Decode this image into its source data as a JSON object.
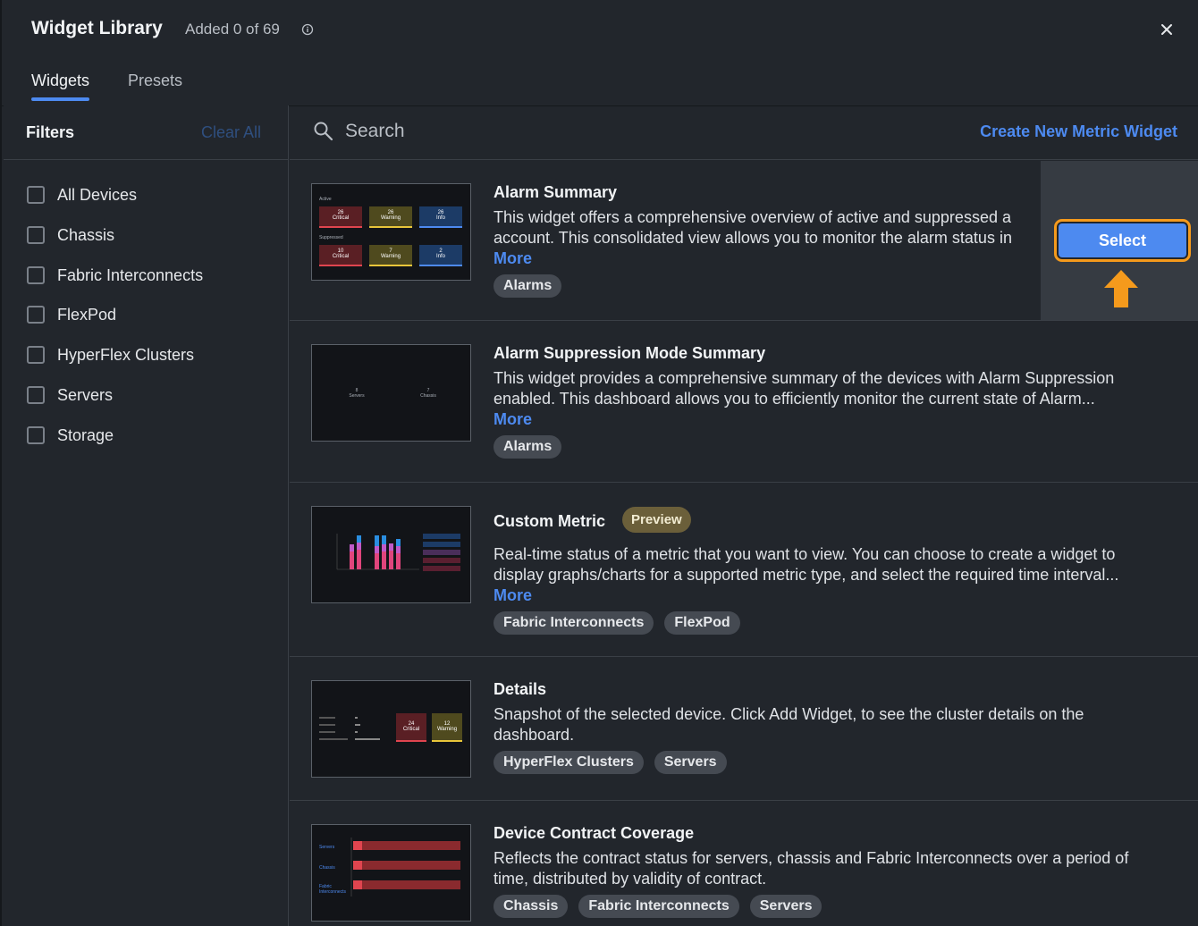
{
  "header": {
    "title": "Widget Library",
    "added_text": "Added 0 of 69"
  },
  "tabs": [
    {
      "label": "Widgets",
      "active": true
    },
    {
      "label": "Presets",
      "active": false
    }
  ],
  "filters": {
    "heading": "Filters",
    "clear_all": "Clear All",
    "items": [
      {
        "label": "All Devices",
        "checked": false
      },
      {
        "label": "Chassis",
        "checked": false
      },
      {
        "label": "Fabric Interconnects",
        "checked": false
      },
      {
        "label": "FlexPod",
        "checked": false
      },
      {
        "label": "HyperFlex Clusters",
        "checked": false
      },
      {
        "label": "Servers",
        "checked": false
      },
      {
        "label": "Storage",
        "checked": false
      }
    ]
  },
  "search": {
    "placeholder": "Search",
    "value": ""
  },
  "create_link": "Create New Metric Widget",
  "select_button": "Select",
  "widgets": [
    {
      "title": "Alarm Summary",
      "desc1": "This widget offers a comprehensive overview of active and suppressed a",
      "desc2": "account. This consolidated view allows you to monitor the alarm status in",
      "more": "More",
      "tags": [
        "Alarms"
      ],
      "thumb": {
        "active": "Active",
        "suppressed": "Suppressed",
        "tiles": [
          {
            "value": "26",
            "label": "Critical"
          },
          {
            "value": "26",
            "label": "Warning"
          },
          {
            "value": "26",
            "label": "Info"
          },
          {
            "value": "10",
            "label": "Critical"
          },
          {
            "value": "7",
            "label": "Warning"
          },
          {
            "value": "2",
            "label": "Info"
          }
        ]
      }
    },
    {
      "title": "Alarm Suppression Mode Summary",
      "desc1": "This widget provides a comprehensive summary of the devices with Alarm Suppression",
      "desc2": "enabled. This dashboard allows you to efficiently monitor the current state of Alarm...",
      "more": "More",
      "tags": [
        "Alarms"
      ],
      "thumb": {
        "a_value": "8",
        "a_label": "Servers",
        "b_value": "7",
        "b_label": "Chassis"
      }
    },
    {
      "title": "Custom Metric",
      "badge": "Preview",
      "desc1": "Real-time status of a metric that you want to view. You can choose to create a widget to",
      "desc2": "display graphs/charts for a supported metric type, and select the required time interval...",
      "more": "More",
      "tags": [
        "Fabric Interconnects",
        "FlexPod"
      ]
    },
    {
      "title": "Details",
      "desc1": "Snapshot of the selected device. Click Add Widget, to see the cluster details on the",
      "desc2": "dashboard.",
      "tags": [
        "HyperFlex Clusters",
        "Servers"
      ],
      "thumb": {
        "tile1_value": "24",
        "tile1_label": "Critical",
        "tile2_value": "12",
        "tile2_label": "Warning"
      }
    },
    {
      "title": "Device Contract Coverage",
      "desc1": "Reflects the contract status for servers, chassis and Fabric Interconnects over a period of",
      "desc2": "time, distributed by validity of contract.",
      "tags": [
        "Chassis",
        "Fabric Interconnects",
        "Servers"
      ],
      "thumb": {
        "rows": [
          "Servers",
          "Chassis",
          "Fabric Interconnects"
        ]
      }
    }
  ],
  "colors": {
    "accent": "#4d8af0",
    "highlight": "#f59a1c",
    "background": "#22262c"
  }
}
